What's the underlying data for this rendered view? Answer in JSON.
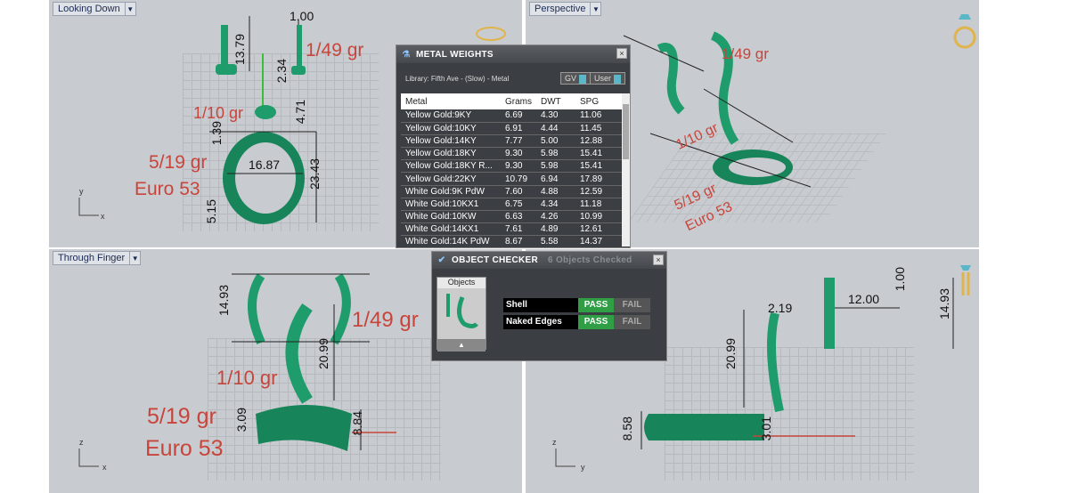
{
  "viewports": {
    "top_left": {
      "label": "Looking Down",
      "axis_v": "y",
      "axis_h": "x",
      "dims": [
        "13.79",
        "1.00",
        "2.34",
        "4.71",
        "1.39",
        "16.87",
        "23.43",
        "5.15"
      ],
      "weights": [
        "1/49 gr",
        "1/10 gr",
        "5/19 gr",
        "Euro 53"
      ]
    },
    "top_right": {
      "label": "Perspective",
      "weights": [
        "1/49 gr",
        "1/10 gr",
        "5/19 gr",
        "Euro 53"
      ]
    },
    "bottom_left": {
      "label": "Through Finger",
      "axis_v": "z",
      "axis_h": "x",
      "dims": [
        "14.93",
        "20.99",
        "3.09",
        "8.84"
      ],
      "weights": [
        "1/49 gr",
        "1/10 gr",
        "5/19 gr",
        "Euro 53"
      ]
    },
    "bottom_right": {
      "axis_v": "z",
      "axis_h": "y",
      "dims": [
        "2.19",
        "12.00",
        "1.00",
        "14.93",
        "20.99",
        "8.58",
        "3.01"
      ]
    }
  },
  "metal_weights": {
    "title": "METAL WEIGHTS",
    "library": "Library: Fifth Ave - (Slow) - Metal",
    "chip_gv": "GV",
    "chip_user": "User",
    "columns": [
      "Metal",
      "Grams",
      "DWT",
      "SPG"
    ],
    "rows": [
      [
        "Yellow Gold:9KY",
        "6.69",
        "4.30",
        "11.06"
      ],
      [
        "Yellow Gold:10KY",
        "6.91",
        "4.44",
        "11.45"
      ],
      [
        "Yellow Gold:14KY",
        "7.77",
        "5.00",
        "12.88"
      ],
      [
        "Yellow Gold:18KY",
        "9.30",
        "5.98",
        "15.41"
      ],
      [
        "Yellow Gold:18KY R...",
        "9.30",
        "5.98",
        "15.41"
      ],
      [
        "Yellow Gold:22KY",
        "10.79",
        "6.94",
        "17.89"
      ],
      [
        "White Gold:9K PdW",
        "7.60",
        "4.88",
        "12.59"
      ],
      [
        "White Gold:10KX1",
        "6.75",
        "4.34",
        "11.18"
      ],
      [
        "White Gold:10KW",
        "6.63",
        "4.26",
        "10.99"
      ],
      [
        "White Gold:14KX1",
        "7.61",
        "4.89",
        "12.61"
      ],
      [
        "White Gold:14K PdW",
        "8.67",
        "5.58",
        "14.37"
      ]
    ]
  },
  "object_checker": {
    "title": "OBJECT CHECKER",
    "count_text": "6  Objects Checked",
    "objects_label": "Objects",
    "checks": [
      {
        "name": "Shell",
        "pass": "PASS",
        "fail": "FAIL"
      },
      {
        "name": "Naked Edges",
        "pass": "PASS",
        "fail": "FAIL"
      }
    ]
  },
  "colors": {
    "ring": "#1f9c6b",
    "annotation": "#c8453b",
    "viewport_bg": "#c8cbcf",
    "pass": "#2f9e45"
  }
}
